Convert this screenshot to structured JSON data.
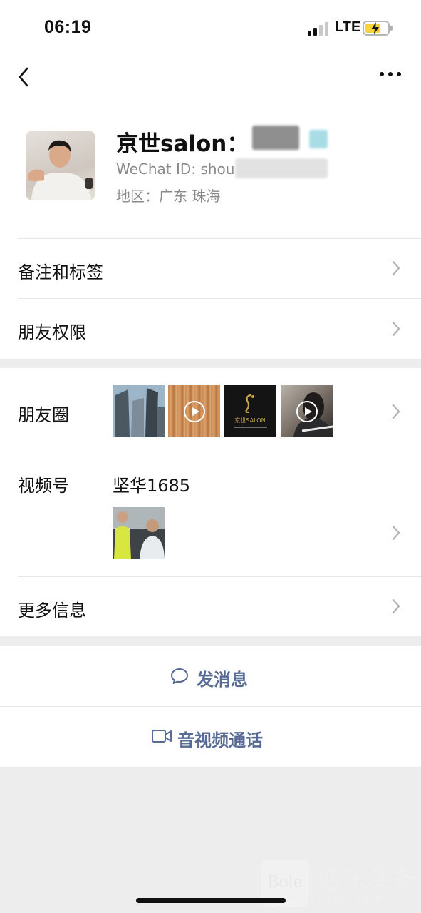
{
  "status_bar": {
    "time": "06:19",
    "network": "LTE"
  },
  "profile": {
    "name_prefix": "京世salon：",
    "wechat_id_prefix": "WeChat ID: shou",
    "region": "地区：广东 珠海"
  },
  "menu": {
    "remarks_tags": "备注和标签",
    "friend_permissions": "朋友权限",
    "moments": "朋友圈",
    "channels": "视频号",
    "channels_name": "坚华1685",
    "more_info": "更多信息"
  },
  "moments_thumbnails": [
    {
      "icon": "building-photo",
      "has_play": false
    },
    {
      "icon": "hair-video",
      "has_play": true
    },
    {
      "icon": "salon-logo",
      "has_play": false,
      "logo_text": "京世SALON"
    },
    {
      "icon": "portrait-video",
      "has_play": true
    }
  ],
  "actions": {
    "send_message": "发消息",
    "video_call": "音视频通话"
  },
  "watermark": {
    "box_text": "Bole",
    "title": "伯乐头条",
    "url": "bole9.com"
  },
  "colors": {
    "link": "#576b95",
    "background": "#ededed",
    "battery": "#f5d33a"
  }
}
